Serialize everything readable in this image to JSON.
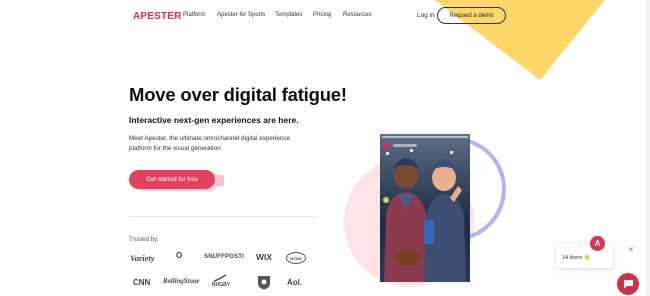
{
  "header": {
    "logo": "APESTER",
    "nav": [
      "Platform",
      "Apester for Sports",
      "Templates",
      "Pricing",
      "Resources"
    ],
    "login": "Log in",
    "demo": "Request a demo"
  },
  "hero": {
    "title": "Move over digital fatigue!",
    "subtitle": "Interactive next-gen experiences are here.",
    "description": "Meet Apester, the ultimate omnichannel digital experience platform for the visual generation",
    "cta": "Get started for free"
  },
  "trusted": {
    "label": "Trusted by:",
    "row1": [
      "Variety",
      "O",
      "SNUFFPOSTI",
      "WIX",
      "NYDN"
    ],
    "row2": [
      "CNN",
      "RollingStone",
      "RUGBY",
      "",
      "Aol."
    ]
  },
  "chat": {
    "greeting": "Hi there 👋",
    "avatar": "A"
  },
  "colors": {
    "brand": "#e52848",
    "cta": "#e0425f",
    "accent_yellow": "#fdd76a",
    "ring_purple": "#b8b0f6"
  }
}
